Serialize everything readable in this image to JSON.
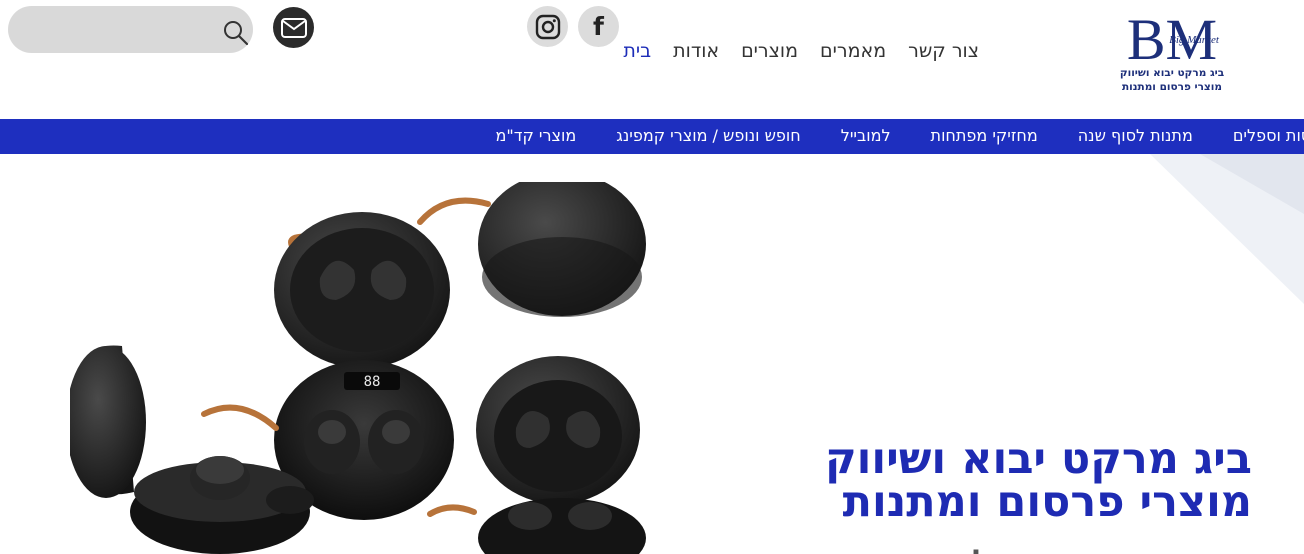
{
  "search": {
    "placeholder": "",
    "icon": "search-icon"
  },
  "contact": {
    "icon": "mail-icon"
  },
  "social": [
    {
      "icon": "instagram-icon"
    },
    {
      "icon": "facebook-icon",
      "glyph": "f"
    }
  ],
  "nav": {
    "items": [
      {
        "label": "בית",
        "active": true
      },
      {
        "label": "אודות"
      },
      {
        "label": "מוצרים"
      },
      {
        "label": "מאמרים"
      },
      {
        "label": "צור קשר"
      }
    ]
  },
  "logo": {
    "initials": "BM",
    "script": "Big Market",
    "line1": "ביג מרקט יבוא ושיווק",
    "line2": "מוצרי פרסום ומתנות"
  },
  "categories": {
    "items": [
      {
        "label": "מוצרי קד\"מ"
      },
      {
        "label": "חופש ונופש / מוצרי קמפינג"
      },
      {
        "label": "למובייל"
      },
      {
        "label": "מחזיקי מפתחות"
      },
      {
        "label": "מתנות לסוף שנה"
      },
      {
        "label": "כוסות וספלים"
      }
    ]
  },
  "hero": {
    "title_line1": "ביג מרקט יבוא ושיווק",
    "title_line2": "מוצרי פרסום ומתנות",
    "subtitle": "מתנות שמדברות אליך",
    "display_digits": "88"
  },
  "colors": {
    "brand_blue": "#1e2fbf",
    "nav_active": "#1d2db8",
    "hero_title": "#1e2bb3",
    "logo_navy": "#1d2f7a"
  }
}
